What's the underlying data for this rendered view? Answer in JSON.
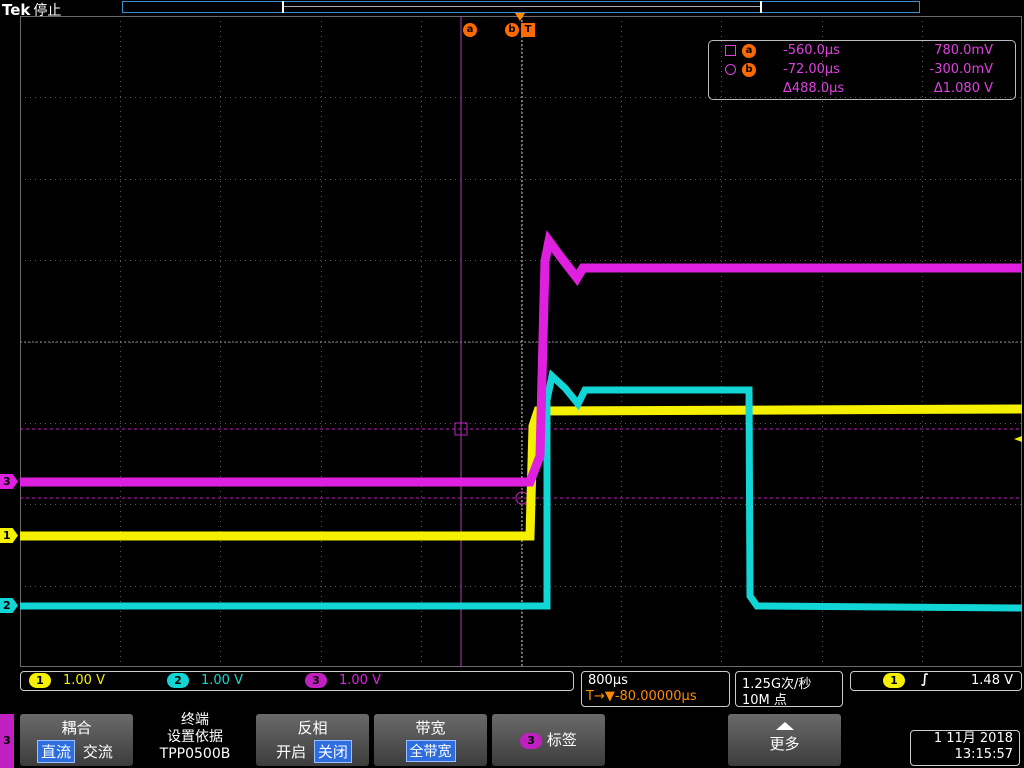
{
  "header": {
    "brand": "Tek",
    "status": "停止"
  },
  "colors": {
    "ch1": "#f5f000",
    "ch2": "#12d6d6",
    "ch3": "#e020e0",
    "cursor": "#ff6a00",
    "grid": "#8a8a8a"
  },
  "cursors": {
    "a_label": "a",
    "b_label": "b",
    "trigger_label": "T"
  },
  "readout": {
    "row_a": {
      "cursor": "a",
      "time": "-560.0µs",
      "value": "780.0mV"
    },
    "row_b": {
      "cursor": "b",
      "time": "-72.00µs",
      "value": "-300.0mV"
    },
    "row_delta": {
      "time": "Δ488.0µs",
      "value": "Δ1.080 V"
    }
  },
  "channel_markers": {
    "ch3": "3",
    "ch1": "1",
    "ch2": "2"
  },
  "status_bar": {
    "channels": [
      {
        "num": "1",
        "scale": "1.00 V"
      },
      {
        "num": "2",
        "scale": "1.00 V"
      },
      {
        "num": "3",
        "scale": "1.00 V"
      }
    ],
    "timebase": {
      "scale": "800µs",
      "delay": "T→▼-80.00000µs"
    },
    "sample": {
      "rate": "1.25G次/秒",
      "points": "10M 点"
    },
    "trigger": {
      "channel": "1",
      "slope": "∫",
      "level": "1.48 V"
    }
  },
  "menu": {
    "tab_label": "3",
    "coupling": {
      "title": "耦合",
      "options": [
        "直流",
        "交流"
      ],
      "selected": "直流"
    },
    "termination": {
      "title": "终端",
      "line2": "设置依据",
      "line3": "TPP0500B"
    },
    "invert": {
      "title": "反相",
      "options": [
        "开启",
        "关闭"
      ],
      "selected": "关闭"
    },
    "bandwidth": {
      "title": "带宽",
      "value": "全带宽"
    },
    "label": {
      "badge": "3",
      "title": "标签"
    },
    "more": {
      "title": "更多"
    }
  },
  "datetime": {
    "date": "1 11月 2018",
    "time": "13:15:57"
  }
}
